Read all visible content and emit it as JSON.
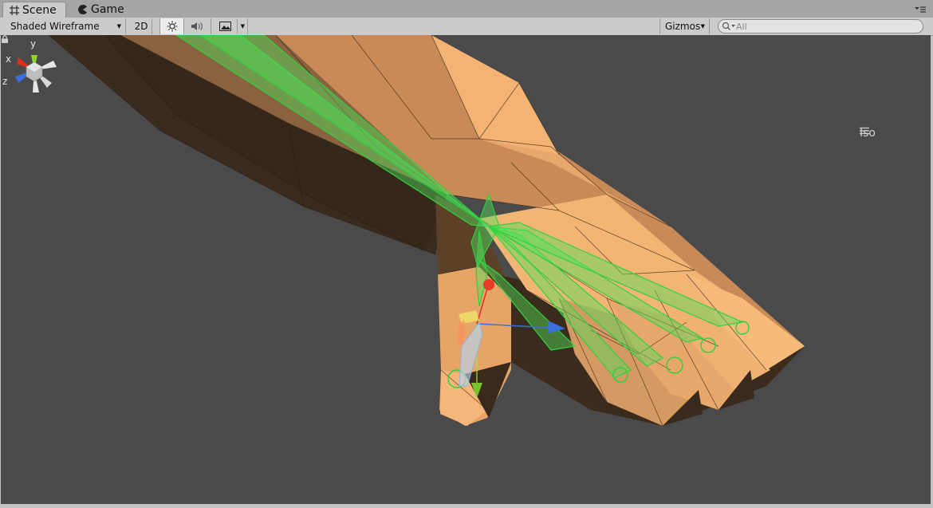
{
  "tabs": [
    {
      "label": "Scene",
      "active": true,
      "icon": "grid-icon"
    },
    {
      "label": "Game",
      "active": false,
      "icon": "pacman-icon"
    }
  ],
  "toolbar": {
    "draw_mode": "Shaded Wireframe",
    "mode_2d": "2D",
    "lighting_icon": "sun-icon",
    "audio_icon": "speaker-icon",
    "effects_icon": "image-icon",
    "gizmos_label": "Gizmos",
    "search_placeholder": "All"
  },
  "scene_gizmo": {
    "axis_x": "x",
    "axis_y": "y",
    "axis_z": "z",
    "projection_label": "Iso",
    "colors": {
      "x": "#e0301e",
      "y": "#8cd12e",
      "z": "#3a6fe0",
      "neutral": "#e6e6e6"
    }
  },
  "colors": {
    "viewport_bg": "#4a4a4a",
    "mesh_light": "#f7b979",
    "mesh_mid": "#c08552",
    "mesh_dark": "#3a2a1e",
    "bones": "#33dd44",
    "toolbar_bg": "#cbcbcb",
    "tabbar_bg": "#a5a5a5"
  }
}
